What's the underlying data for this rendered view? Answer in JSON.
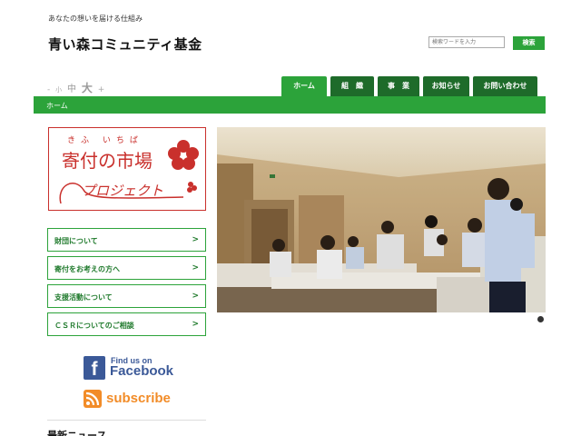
{
  "header": {
    "tagline": "あなたの想いを届ける仕組み",
    "site_title": "青い森コミュニティ基金",
    "search_placeholder": "検索ワードを入力",
    "search_button": "検索"
  },
  "font_size_control": {
    "minus": "-",
    "small": "小",
    "medium": "中",
    "large": "大",
    "plus": "+"
  },
  "nav": {
    "items": [
      {
        "label": "ホーム",
        "active": true
      },
      {
        "label": "組　織",
        "active": false
      },
      {
        "label": "事　業",
        "active": false
      },
      {
        "label": "お知らせ",
        "active": false
      },
      {
        "label": "お問い合わせ",
        "active": false
      }
    ]
  },
  "breadcrumb": {
    "current": "ホーム"
  },
  "banner": {
    "ruby": "きふ いちば",
    "main": "寄付の市場",
    "sub": "プロジェクト"
  },
  "side_menu": {
    "items": [
      {
        "label": "財団について",
        "arrow": ">"
      },
      {
        "label": "寄付をお考えの方へ",
        "arrow": ">"
      },
      {
        "label": "支援活動について",
        "arrow": ">"
      },
      {
        "label": "ＣＳＲについてのご相談",
        "arrow": ">"
      }
    ]
  },
  "social": {
    "facebook_small": "Find us on",
    "facebook_big": "Facebook",
    "rss": "subscribe"
  },
  "news": {
    "heading": "最新ニュース"
  },
  "colors": {
    "accent_green": "#2ca33a",
    "nav_dark_green": "#1e6b2a",
    "banner_red": "#c9302c",
    "facebook_blue": "#3b5998",
    "rss_orange": "#f28c28"
  }
}
